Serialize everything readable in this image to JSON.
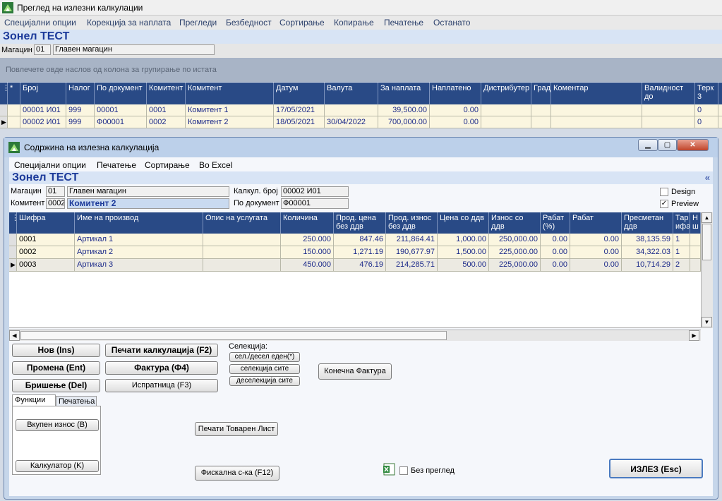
{
  "main": {
    "title": "Преглед на излезни калкулации",
    "menu": [
      "Специјални опции",
      "Корекција за наплата",
      "Прегледи",
      "Безбедност",
      "Сортирање",
      "Копирање",
      "Печатење",
      "Останато"
    ],
    "company": "Зонел ТЕСТ",
    "warehouse_label": "Магацин",
    "warehouse_code": "01",
    "warehouse_name": "Главен магацин",
    "group_hint": "Повлечете овде наслов од колона за групирање по истата",
    "columns": [
      "Број",
      "Налог",
      "По документ",
      "Комитент",
      "Комитент",
      "Датум",
      "Валута",
      "За наплата",
      "Наплатено",
      "Дистрибутер",
      "Град",
      "Коментар",
      "Валидност до",
      "Терк 3"
    ],
    "rows": [
      {
        "broj": "00001",
        "unit": "И01",
        "nalog": "999",
        "po_dok": "00001",
        "kom_code": "0001",
        "kom_name": "Комитент 1",
        "datum": "17/05/2021",
        "valuta": "",
        "za_naplata": "39,500.00",
        "naplateno": "0.00",
        "terk": "0"
      },
      {
        "broj": "00002",
        "unit": "И01",
        "nalog": "999",
        "po_dok": "Ф00001",
        "kom_code": "0002",
        "kom_name": "Комитент 2",
        "datum": "18/05/2021",
        "valuta": "30/04/2022",
        "za_naplata": "700,000.00",
        "naplateno": "0.00",
        "terk": "0"
      }
    ]
  },
  "child": {
    "title": "Содржина на излезна калкулација",
    "menu": [
      "Специјални опции",
      "Печатење",
      "Сортирање",
      "Во Excel"
    ],
    "company": "Зонел ТЕСТ",
    "collapse": "«",
    "warehouse_label": "Магацин",
    "warehouse_code": "01",
    "warehouse_name": "Главен магацин",
    "client_label": "Комитент",
    "client_code": "0002",
    "client_name": "Комитент 2",
    "calc_label": "Калкул. број",
    "calc_value": "00002  И01",
    "doc_label": "По документ",
    "doc_value": "Ф00001",
    "design_label": "Design",
    "preview_label": "Preview",
    "preview_checked": "✓",
    "columns": [
      "Шифра",
      "Име на производ",
      "Опис на услугата",
      "Количина",
      "Прод. цена без ддв",
      "Прод. износ без ддв",
      "Цена со ддв",
      "Износ со ддв",
      "Рабат (%)",
      "Рабат",
      "Пресметан ддв",
      "Тар ифа",
      "Н ш"
    ],
    "rows": [
      {
        "code": "0001",
        "name": "Артикал 1",
        "qty": "250.000",
        "price": "847.46",
        "amount": "211,864.41",
        "price_vat": "1,000.00",
        "amount_vat": "250,000.00",
        "disc_pct": "0.00",
        "disc": "0.00",
        "vat": "38,135.59",
        "tariff": "1"
      },
      {
        "code": "0002",
        "name": "Артикал 2",
        "qty": "150.000",
        "price": "1,271.19",
        "amount": "190,677.97",
        "price_vat": "1,500.00",
        "amount_vat": "225,000.00",
        "disc_pct": "0.00",
        "disc": "0.00",
        "vat": "34,322.03",
        "tariff": "1"
      },
      {
        "code": "0003",
        "name": "Артикал 3",
        "qty": "450.000",
        "price": "476.19",
        "amount": "214,285.71",
        "price_vat": "500.00",
        "amount_vat": "225,000.00",
        "disc_pct": "0.00",
        "disc": "0.00",
        "vat": "10,714.29",
        "tariff": "2"
      }
    ],
    "buttons": {
      "new": "Нов (Ins)",
      "edit": "Промена (Ent)",
      "delete": "Бришење (Del)",
      "print_calc": "Печати калкулација (F2)",
      "invoice": "Фактура (Ф4)",
      "dispatch": "Испратница (F3)",
      "selection_label": "Селекција:",
      "sel_one": "сел./десел еден(*)",
      "sel_all": "селекција сите",
      "desel_all": "деселекција сите",
      "final_invoice": "Конечна Фактура",
      "print_waybill": "Печати Товарен Лист",
      "fiscal": "Фискална с-ка (F12)",
      "no_preview": "Без преглед",
      "exit": "ИЗЛЕЗ (Esc)"
    },
    "tabs": {
      "functions": "Функции",
      "printing": "Печатења",
      "total": "Вкупен износ (B)",
      "calculator": "Калкулатор (K)"
    }
  }
}
